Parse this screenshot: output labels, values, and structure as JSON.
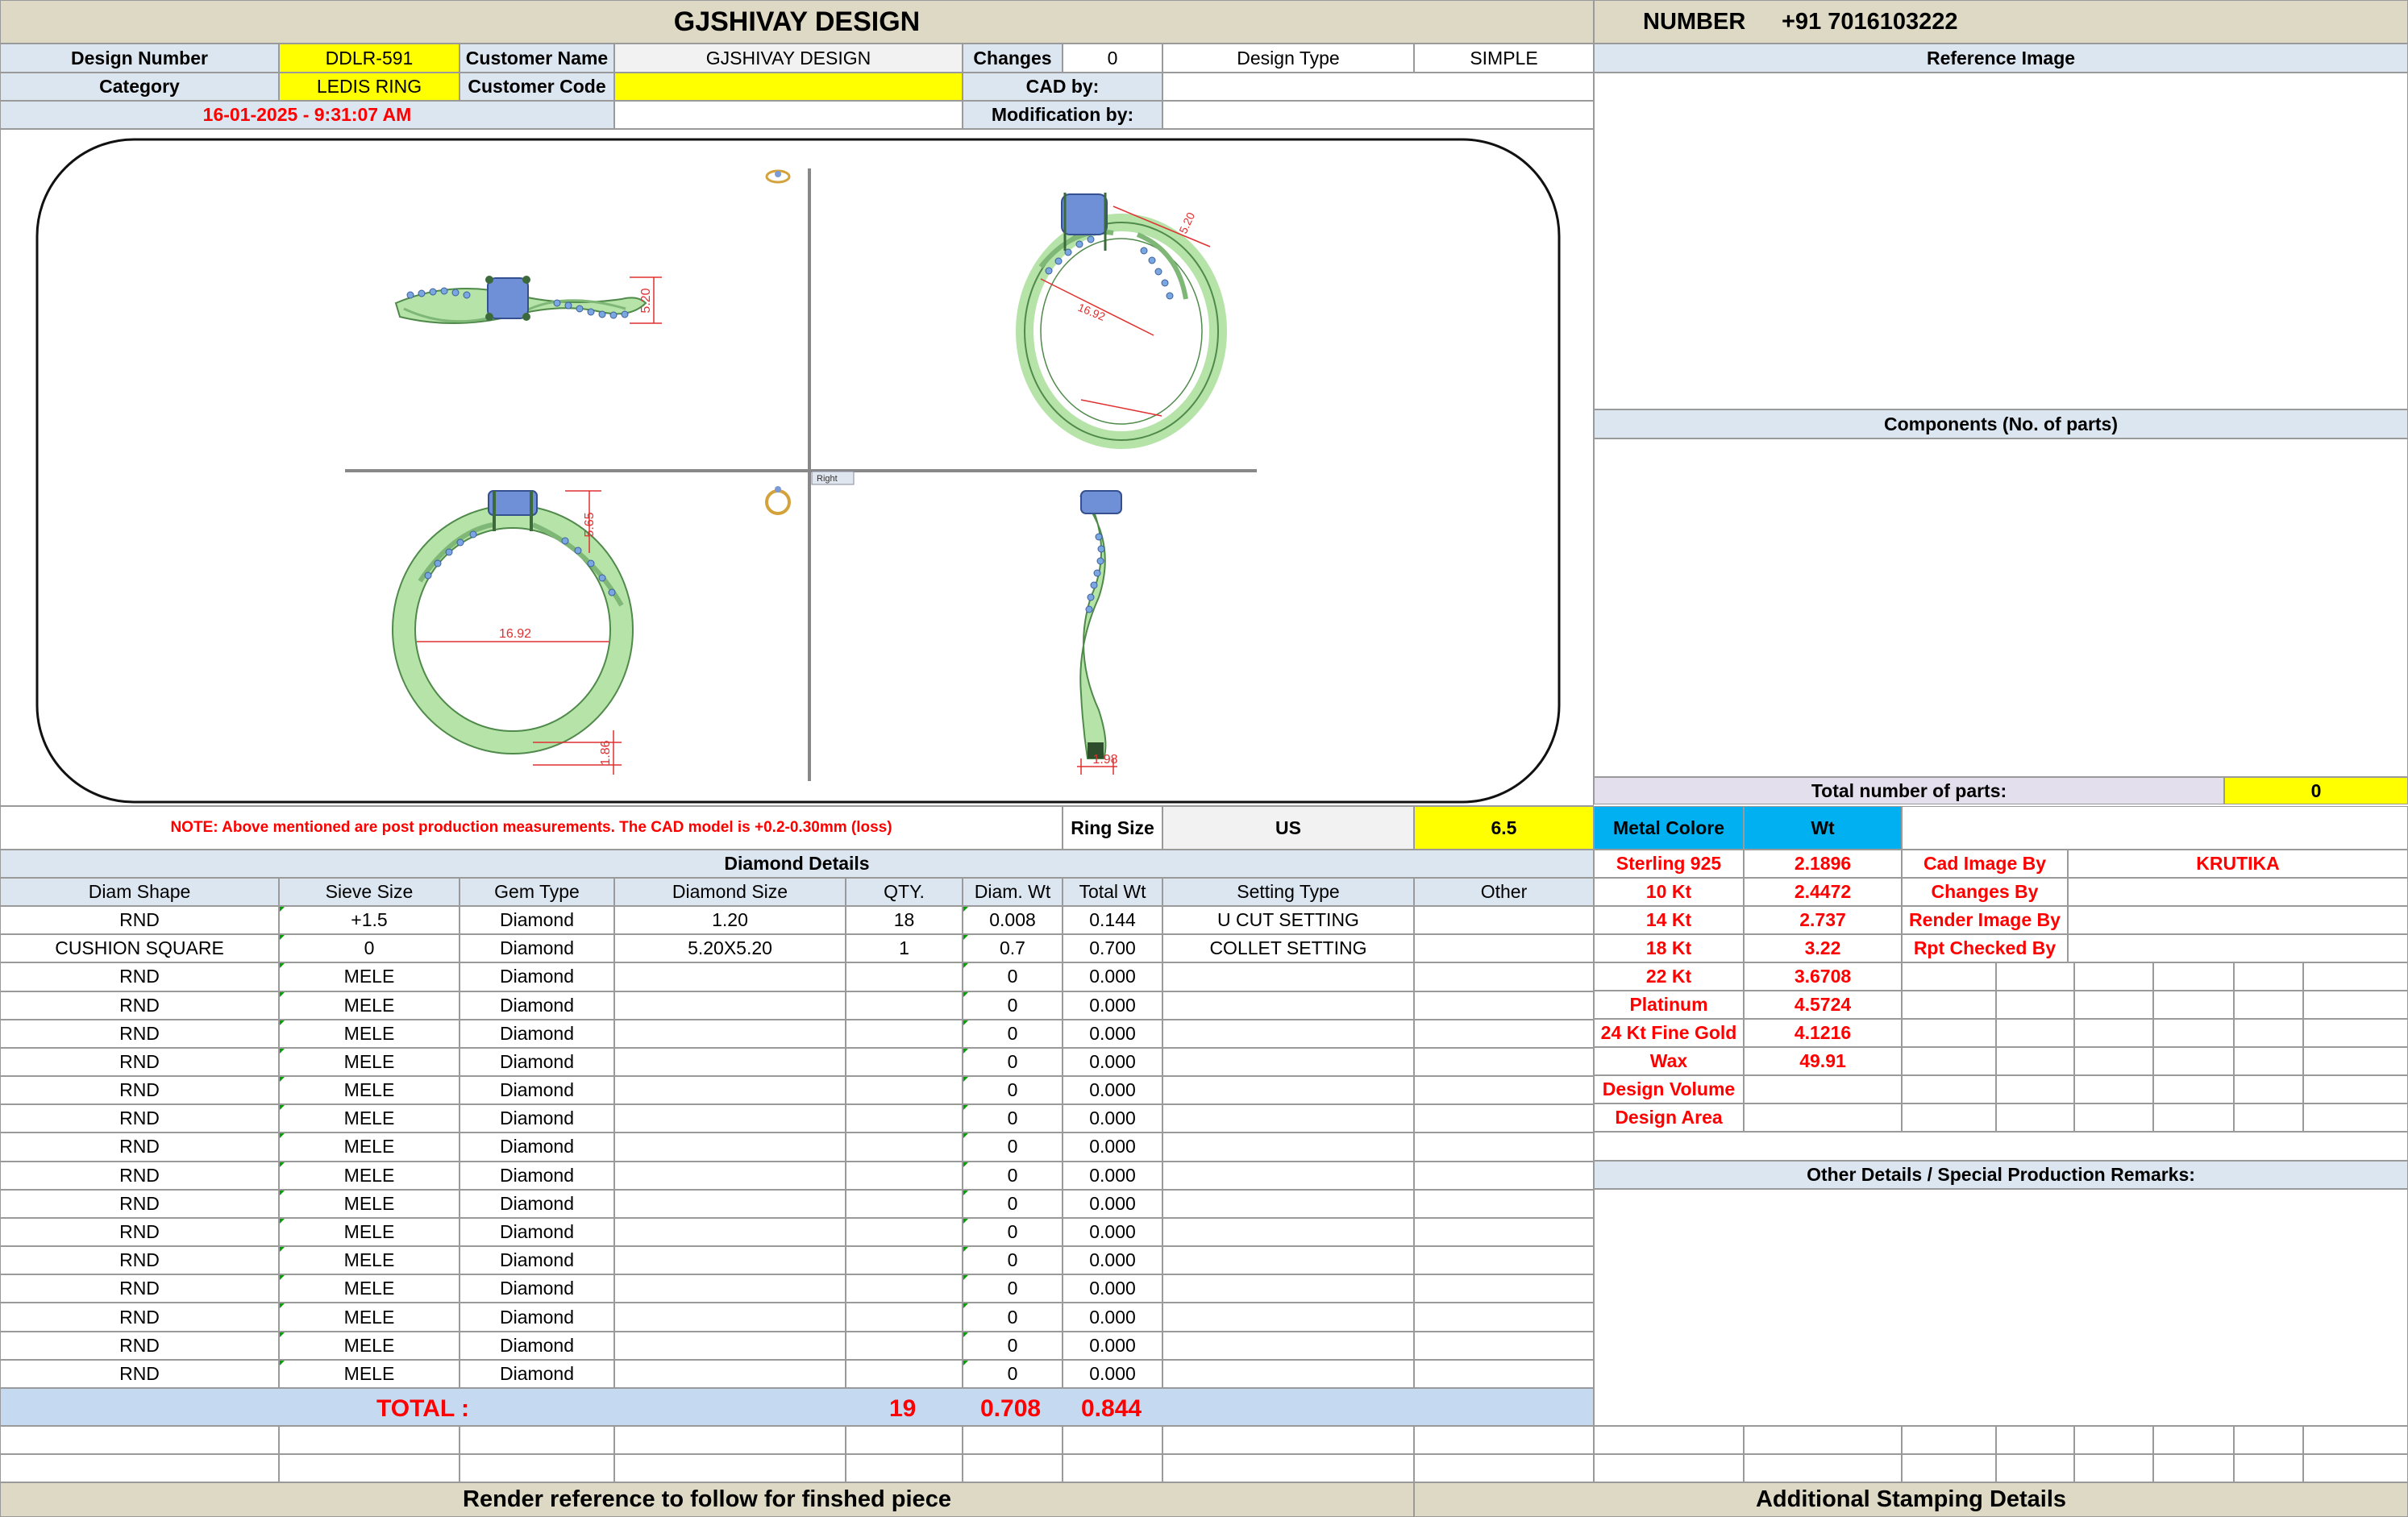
{
  "header": {
    "title": "GJSHIVAY DESIGN",
    "number_label": "NUMBER",
    "number_value": "+91 7016103222"
  },
  "info": {
    "design_number_label": "Design Number",
    "design_number": "DDLR-591",
    "customer_name_label": "Customer Name",
    "customer_name": "GJSHIVAY DESIGN",
    "changes_label": "Changes",
    "changes": "0",
    "design_type_label": "Design Type",
    "design_type": "SIMPLE",
    "category_label": "Category",
    "category": "LEDIS RING",
    "customer_code_label": "Customer Code",
    "customer_code": "",
    "cad_by_label": "CAD by:",
    "cad_by": "",
    "date": "16-01-2025 - 9:31:07 AM",
    "modification_by_label": "Modification by:",
    "modification_by": ""
  },
  "reference": {
    "reference_image_label": "Reference Image",
    "components_label": "Components (No. of parts)",
    "total_parts_label": "Total number of parts:",
    "total_parts": "0"
  },
  "drawing": {
    "dim_width_top": "5.20",
    "dim_side_prong": "5.20",
    "dim_side_diameter": "16.92",
    "dim_front_height": "5.65",
    "dim_front_diameter": "16.92",
    "dim_front_shank": "1.86",
    "dim_side_shank": "1.98",
    "viewport_label": "Right"
  },
  "note": {
    "text": "NOTE: Above mentioned are post production measurements. The CAD model is +0.2-0.30mm (loss)",
    "ring_size_label": "Ring Size",
    "ring_size_system": "US",
    "ring_size": "6.5"
  },
  "metal": {
    "header_metal": "Metal Colore",
    "header_wt": "Wt",
    "rows": [
      {
        "name": "Sterling 925",
        "wt": "2.1896"
      },
      {
        "name": "10 Kt",
        "wt": "2.4472"
      },
      {
        "name": "14 Kt",
        "wt": "2.737"
      },
      {
        "name": "18 Kt",
        "wt": "3.22"
      },
      {
        "name": "22 Kt",
        "wt": "3.6708"
      },
      {
        "name": "Platinum",
        "wt": "4.5724"
      },
      {
        "name": "24 Kt Fine Gold",
        "wt": "4.1216"
      },
      {
        "name": "Wax",
        "wt": "49.91"
      },
      {
        "name": "Design Volume",
        "wt": ""
      },
      {
        "name": "Design Area",
        "wt": ""
      }
    ]
  },
  "credits": {
    "rows": [
      {
        "label": "Cad Image By",
        "value": "KRUTIKA"
      },
      {
        "label": "Changes By",
        "value": ""
      },
      {
        "label": "Render Image By",
        "value": ""
      },
      {
        "label": "Rpt Checked By",
        "value": ""
      }
    ]
  },
  "remarks_label": "Other Details / Special Production Remarks:",
  "diamond": {
    "title": "Diamond Details",
    "columns": [
      "Diam Shape",
      "Sieve Size",
      "Gem Type",
      "Diamond Size",
      "QTY.",
      "Diam. Wt",
      "Total Wt",
      "Setting Type",
      "Other"
    ],
    "rows": [
      [
        "RND",
        "+1.5",
        "Diamond",
        "1.20",
        "18",
        "0.008",
        "0.144",
        "U CUT SETTING",
        ""
      ],
      [
        "CUSHION SQUARE",
        "0",
        "Diamond",
        "5.20X5.20",
        "1",
        "0.7",
        "0.700",
        "COLLET SETTING",
        ""
      ],
      [
        "RND",
        "MELE",
        "Diamond",
        "",
        "",
        "0",
        "0.000",
        "",
        ""
      ],
      [
        "RND",
        "MELE",
        "Diamond",
        "",
        "",
        "0",
        "0.000",
        "",
        ""
      ],
      [
        "RND",
        "MELE",
        "Diamond",
        "",
        "",
        "0",
        "0.000",
        "",
        ""
      ],
      [
        "RND",
        "MELE",
        "Diamond",
        "",
        "",
        "0",
        "0.000",
        "",
        ""
      ],
      [
        "RND",
        "MELE",
        "Diamond",
        "",
        "",
        "0",
        "0.000",
        "",
        ""
      ],
      [
        "RND",
        "MELE",
        "Diamond",
        "",
        "",
        "0",
        "0.000",
        "",
        ""
      ],
      [
        "RND",
        "MELE",
        "Diamond",
        "",
        "",
        "0",
        "0.000",
        "",
        ""
      ],
      [
        "RND",
        "MELE",
        "Diamond",
        "",
        "",
        "0",
        "0.000",
        "",
        ""
      ],
      [
        "RND",
        "MELE",
        "Diamond",
        "",
        "",
        "0",
        "0.000",
        "",
        ""
      ],
      [
        "RND",
        "MELE",
        "Diamond",
        "",
        "",
        "0",
        "0.000",
        "",
        ""
      ],
      [
        "RND",
        "MELE",
        "Diamond",
        "",
        "",
        "0",
        "0.000",
        "",
        ""
      ],
      [
        "RND",
        "MELE",
        "Diamond",
        "",
        "",
        "0",
        "0.000",
        "",
        ""
      ],
      [
        "RND",
        "MELE",
        "Diamond",
        "",
        "",
        "0",
        "0.000",
        "",
        ""
      ],
      [
        "RND",
        "MELE",
        "Diamond",
        "",
        "",
        "0",
        "0.000",
        "",
        ""
      ],
      [
        "RND",
        "MELE",
        "Diamond",
        "",
        "",
        "0",
        "0.000",
        "",
        ""
      ]
    ],
    "total_label": "TOTAL :",
    "total_qty": "19",
    "total_diam_wt": "0.708",
    "total_wt": "0.844"
  },
  "footer": {
    "render_reference": "Render reference to follow for finshed piece",
    "stamping": "Additional Stamping Details"
  },
  "colors": {
    "header_tan": "#ddd9c4",
    "label_blue": "#dce6f1",
    "highlight_yellow": "#ffff00",
    "metal_cyan": "#00b0f0",
    "alert_red": "#ff0000",
    "ring_green": "#b5e3a8",
    "stone_blue": "#6f8fd6"
  }
}
